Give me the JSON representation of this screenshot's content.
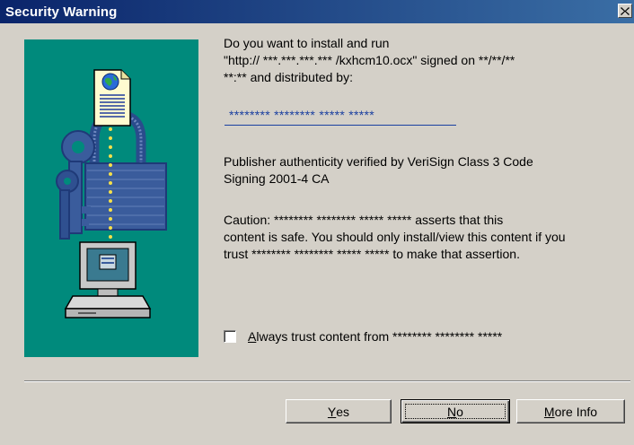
{
  "window": {
    "title": "Security Warning"
  },
  "content": {
    "intro": "Do you want to install and run\n\"http:// ***.***.***.*** /kxhcm10.ocx\" signed on **/**/**\n**:** and distributed by:",
    "publisher_link": "******** ******** ***** *****",
    "verification": "Publisher authenticity verified by VeriSign Class 3 Code\nSigning 2001-4 CA",
    "caution": "Caution: ******** ******** ***** ***** asserts that this\ncontent is safe.  You should only install/view this content if you\ntrust ******** ******** ***** ***** to make that assertion."
  },
  "checkbox": {
    "mnemonic": "A",
    "label_rest": "lways trust content from ******** ******** *****",
    "checked": false
  },
  "buttons": {
    "yes_mnemonic": "Y",
    "yes_rest": "es",
    "no_mnemonic": "N",
    "no_rest": "o",
    "more_mnemonic": "M",
    "more_rest": "ore Info"
  },
  "icons": {
    "close": "close-icon",
    "document": "document-icon",
    "globe": "globe-icon",
    "lock": "lock-icon",
    "keys": "keys-icon",
    "computer": "computer-icon"
  },
  "colors": {
    "titlebar_start": "#0a246a",
    "titlebar_end": "#3a6ea5",
    "panel": "#008a7c",
    "link": "#1a3fa0",
    "dialog_bg": "#d4d0c8"
  }
}
